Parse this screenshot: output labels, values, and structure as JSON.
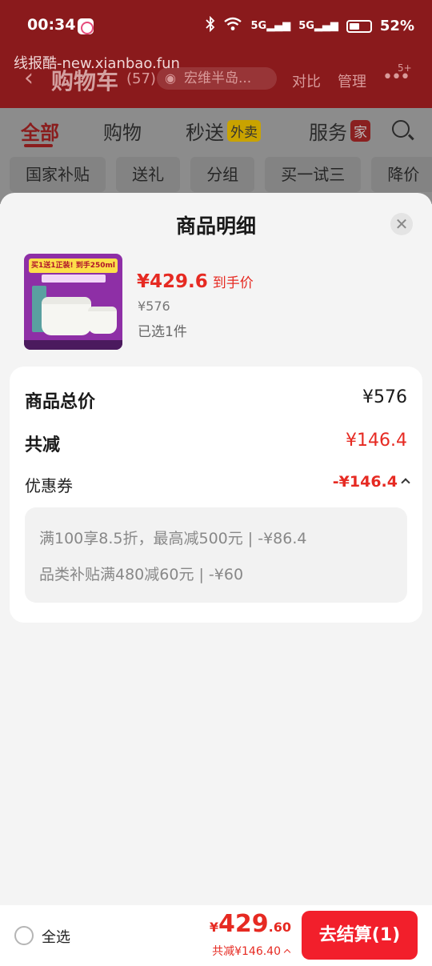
{
  "status_bar": {
    "time": "00:34",
    "icons": [
      "app-icon",
      "bluetooth-icon",
      "wifi-icon",
      "signal-5g-icon",
      "signal-5g-icon",
      "battery-icon"
    ],
    "network1": "5G",
    "network2": "5G",
    "battery": "52%"
  },
  "watermark": "线报酷-new.xianbao.fun",
  "nav": {
    "title": "购物车",
    "count": "(57)",
    "location": "宏维半岛...",
    "compare": "对比",
    "manage": "管理",
    "more_badge": "5+"
  },
  "tabs": [
    {
      "label": "全部"
    },
    {
      "label": "购物"
    },
    {
      "label": "秒送",
      "badge": "外卖"
    },
    {
      "label": "服务",
      "badge": "家"
    }
  ],
  "chips": [
    "国家补贴",
    "送礼",
    "分组",
    "买一试三",
    "降价"
  ],
  "sheet": {
    "title": "商品明细",
    "product": {
      "image_banner": "买1送1正装! 到手250ml量",
      "price": "¥429.6",
      "price_label": "到手价",
      "original_price": "¥576",
      "selected": "已选1件"
    },
    "summary": {
      "total_label": "商品总价",
      "total_value": "¥576",
      "reduce_label": "共减",
      "reduce_value": "¥146.4",
      "coupon_label": "优惠券",
      "coupon_value": "-¥146.4",
      "coupons": [
        "满100享8.5折，最高减500元 | -¥86.4",
        "品类补贴满480减60元 | -¥60"
      ]
    }
  },
  "bottom": {
    "select_all": "全选",
    "currency": "¥",
    "total_int": "429",
    "total_dec": ".60",
    "discount": "共减¥146.40",
    "checkout": "去结算(1)"
  },
  "colors": {
    "accent": "#e62a22",
    "checkout_button": "#f21f2b",
    "header_dim": "#8a1a1c"
  }
}
